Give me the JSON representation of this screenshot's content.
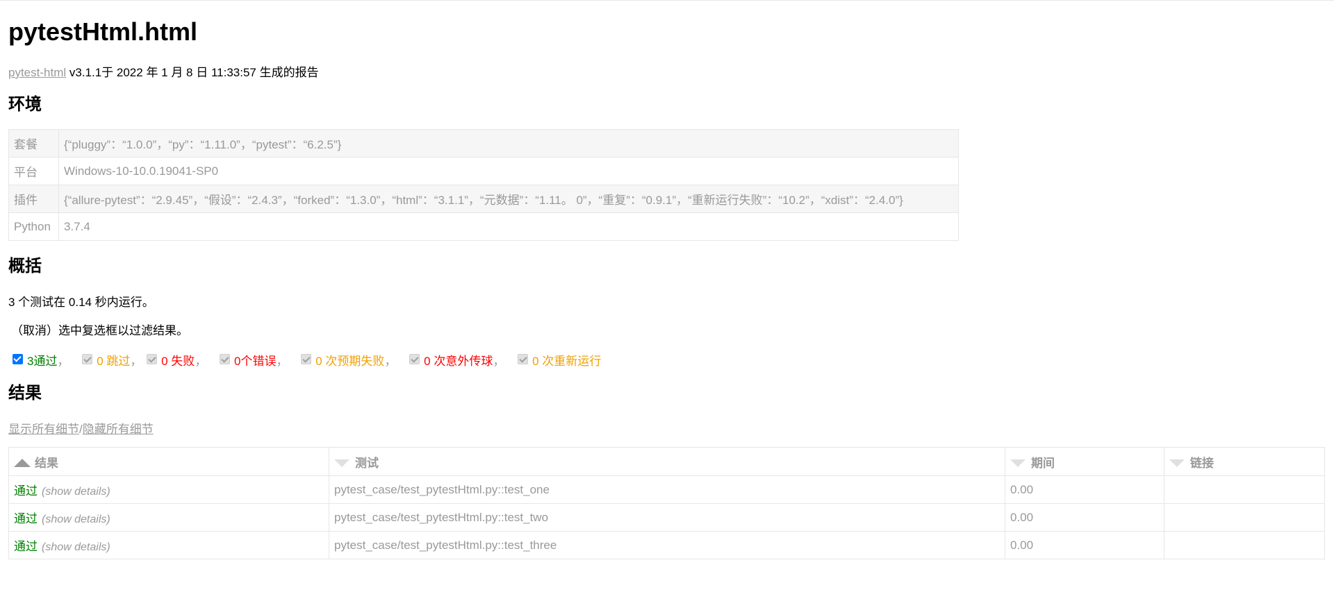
{
  "title": "pytestHtml.html",
  "generated": {
    "link_text": "pytest-html",
    "text": " v3.1.1于 2022 年 1 月 8 日 11:33:57 生成的报告"
  },
  "environment": {
    "heading": "环境",
    "rows": [
      {
        "key": "套餐",
        "value": "{“pluggy”：“1.0.0”，“py”：“1.11.0”，“pytest”：“6.2.5”}"
      },
      {
        "key": "平台",
        "value": "Windows-10-10.0.19041-SP0"
      },
      {
        "key": "插件",
        "value": "{“allure-pytest”：“2.9.45”，“假设”：“2.4.3”，“forked”：“1.3.0”，“html”：“3.1.1”，“元数据”：“1.11。 0”，“重复”：“0.9.1”，“重新运行失败”：“10.2”，“xdist”：“2.4.0”}"
      },
      {
        "key": "Python",
        "value": "3.7.4"
      }
    ]
  },
  "summary": {
    "heading": "概括",
    "run_text": "3 个测试在 0.14 秒内运行。",
    "filter_hint": "（取消）选中复选框以过滤结果。",
    "filters": [
      {
        "label": "3通过",
        "checked": true,
        "color": "#008000"
      },
      {
        "label": "0 跳过",
        "checked": false,
        "color": "#f0a000"
      },
      {
        "label": "0 失败",
        "checked": false,
        "color": "#ff0000"
      },
      {
        "label": "0个错误",
        "checked": false,
        "color": "#ff0000"
      },
      {
        "label": "0 次预期失败",
        "checked": false,
        "color": "#f0a000"
      },
      {
        "label": "0 次意外传球",
        "checked": false,
        "color": "#ff0000"
      },
      {
        "label": "0 次重新运行",
        "checked": false,
        "color": "#f0a000"
      }
    ],
    "separator": "，"
  },
  "results": {
    "heading": "结果",
    "show_all": "显示所有细节",
    "slash": "/",
    "hide_all": "隐藏所有细节",
    "columns": [
      "结果",
      "测试",
      "期间",
      "链接"
    ],
    "rows": [
      {
        "result": "通过",
        "details": "(show details)",
        "test": "pytest_case/test_pytestHtml.py::test_one",
        "duration": "0.00",
        "links": ""
      },
      {
        "result": "通过",
        "details": "(show details)",
        "test": "pytest_case/test_pytestHtml.py::test_two",
        "duration": "0.00",
        "links": ""
      },
      {
        "result": "通过",
        "details": "(show details)",
        "test": "pytest_case/test_pytestHtml.py::test_three",
        "duration": "0.00",
        "links": ""
      }
    ]
  }
}
